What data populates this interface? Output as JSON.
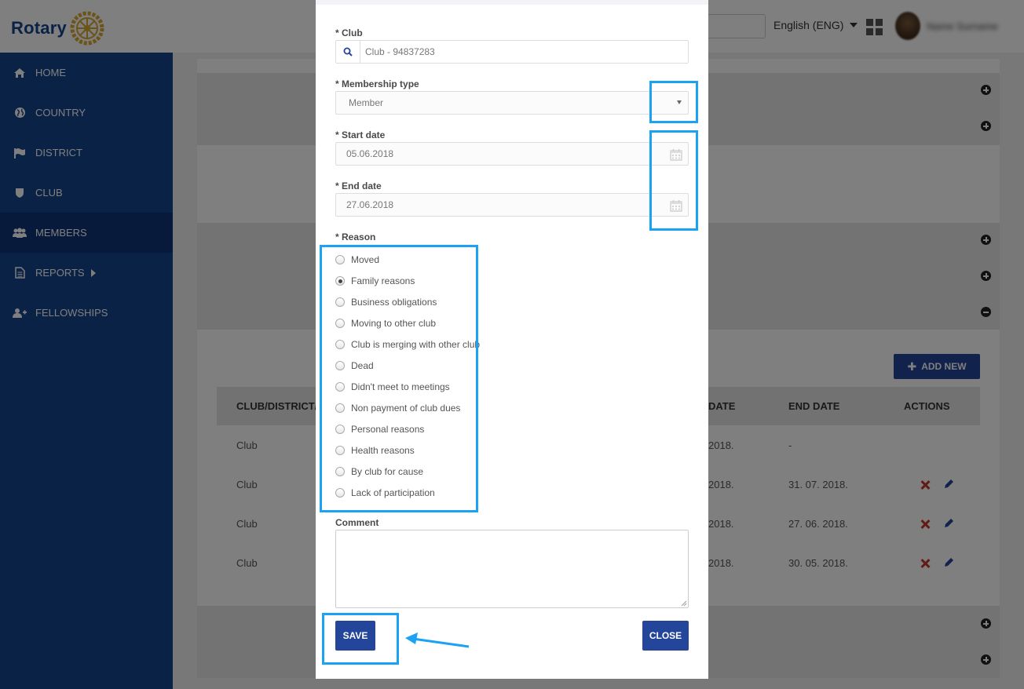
{
  "app": {
    "logo_text": "Rotary",
    "language": "English (ENG)",
    "username": "Name Surname"
  },
  "sidebar": {
    "items": [
      {
        "label": "HOME",
        "icon": "home-icon"
      },
      {
        "label": "COUNTRY",
        "icon": "globe-icon"
      },
      {
        "label": "DISTRICT",
        "icon": "flag-icon"
      },
      {
        "label": "CLUB",
        "icon": "shield-icon"
      },
      {
        "label": "MEMBERS",
        "icon": "users-icon",
        "active": true
      },
      {
        "label": "REPORTS",
        "icon": "document-icon"
      },
      {
        "label": "FELLOWSHIPS",
        "icon": "user-plus-icon"
      }
    ]
  },
  "background_table": {
    "add_new_label": "ADD NEW",
    "columns": [
      "CLUB/DISTRICT/C",
      "DATE",
      "END DATE",
      "ACTIONS"
    ],
    "rows": [
      {
        "type": "Club",
        "start": "2018.",
        "end": "-"
      },
      {
        "type": "Club",
        "start": "2018.",
        "end": "31. 07. 2018."
      },
      {
        "type": "Club",
        "start": "2018.",
        "end": "27. 06. 2018."
      },
      {
        "type": "Club",
        "start": "2018.",
        "end": "30. 05. 2018."
      }
    ]
  },
  "modal": {
    "club_label": "* Club",
    "club_value": "Club - 94837283",
    "membership_label": "* Membership type",
    "membership_value": "Member",
    "start_label": "* Start date",
    "start_value": "05.06.2018",
    "end_label": "* End date",
    "end_value": "27.06.2018",
    "reason_label": "* Reason",
    "reasons": [
      {
        "label": "Moved",
        "checked": false
      },
      {
        "label": "Family reasons",
        "checked": true
      },
      {
        "label": "Business obligations",
        "checked": false
      },
      {
        "label": "Moving to other club",
        "checked": false
      },
      {
        "label": "Club is merging with other club",
        "checked": false
      },
      {
        "label": "Dead",
        "checked": false
      },
      {
        "label": "Didn't meet to meetings",
        "checked": false
      },
      {
        "label": "Non payment of club dues",
        "checked": false
      },
      {
        "label": "Personal reasons",
        "checked": false
      },
      {
        "label": "Health reasons",
        "checked": false
      },
      {
        "label": "By club for cause",
        "checked": false
      },
      {
        "label": "Lack of participation",
        "checked": false
      }
    ],
    "comment_label": "Comment",
    "comment_value": "",
    "save_label": "SAVE",
    "close_label": "CLOSE"
  },
  "colors": {
    "brand_blue": "#17458f",
    "button_blue": "#23459a",
    "annotation_blue": "#1aa3f5"
  }
}
